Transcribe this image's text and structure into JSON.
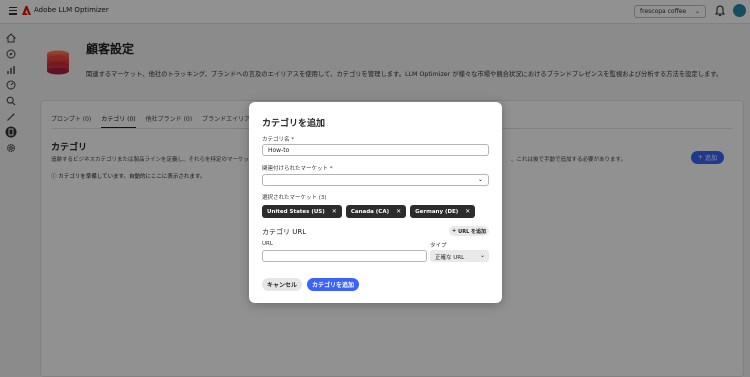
{
  "app": {
    "title": "Adobe LLM Optimizer",
    "org_selected": "frescopa coffee"
  },
  "page": {
    "title": "顧客設定",
    "description": "関連するマーケット、他社のトラッキング、ブランドへの言及のエイリアスを使用して、カテゴリを管理します。LLM Optimizer が様々な市場や競合状況におけるブランドプレゼンスを監視および分析する方法を設定します。"
  },
  "tabs": [
    {
      "label": "プロンプト (0)"
    },
    {
      "label": "カテゴリ (0)"
    },
    {
      "label": "他社ブランド (0)"
    },
    {
      "label": "ブランドエイリアス (…"
    }
  ],
  "section": {
    "title": "カテゴリ",
    "description_left": "追跡するビジネスカテゴリまたは製品ラインを定義し、それらを特定のマーケッ",
    "description_right": "、これは後で手動で追加する必要があります。",
    "info": "カテゴリを準備しています。自動的にここに表示されます。",
    "add_label": "追加"
  },
  "modal": {
    "title": "カテゴリを追加",
    "name_label": "カテゴリ名",
    "name_value": "How-to",
    "market_label": "関連付けられたマーケット",
    "market_value": "",
    "selected_label": "選択されたマーケット (3)",
    "markets": [
      {
        "label": "United States (US)"
      },
      {
        "label": "Canada (CA)"
      },
      {
        "label": "Germany (DE)"
      }
    ],
    "url_section_title": "カテゴリ URL",
    "url_add_label": "URL を追加",
    "url_label": "URL",
    "url_value": "",
    "type_label": "タイプ",
    "type_value": "正確な URL",
    "cancel_label": "キャンセル",
    "submit_label": "カテゴリを追加"
  },
  "colors": {
    "accent": "#3b63fb",
    "chip_bg": "#2c2c2c",
    "brand_red": "#eb1000"
  }
}
